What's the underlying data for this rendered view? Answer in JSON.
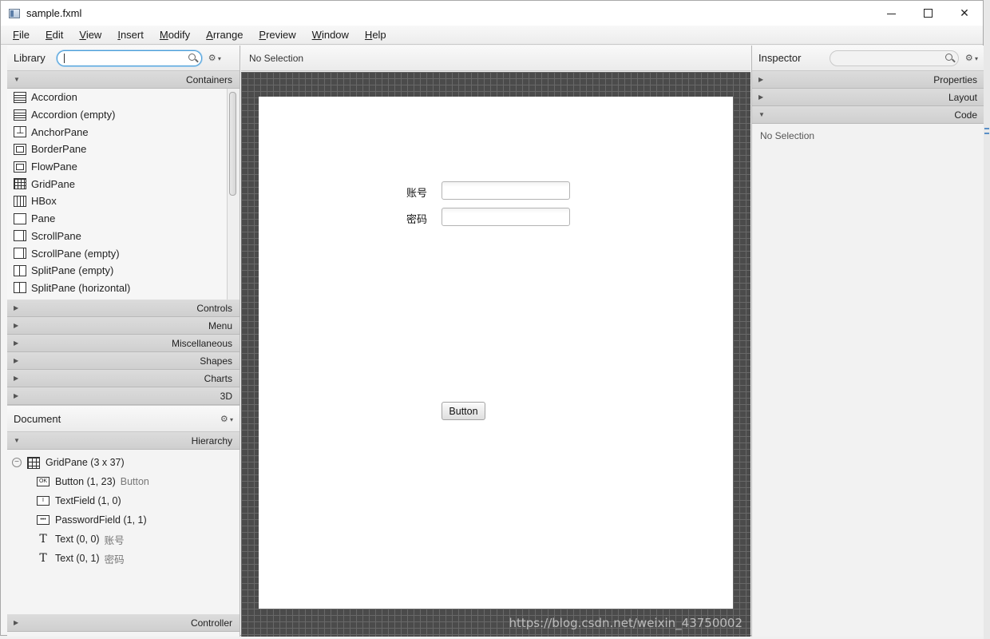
{
  "window": {
    "title": "sample.fxml"
  },
  "menu": [
    {
      "u": "F",
      "rest": "ile"
    },
    {
      "u": "E",
      "rest": "dit"
    },
    {
      "u": "V",
      "rest": "iew"
    },
    {
      "u": "I",
      "rest": "nsert"
    },
    {
      "u": "M",
      "rest": "odify"
    },
    {
      "u": "A",
      "rest": "rrange"
    },
    {
      "u": "P",
      "rest": "review"
    },
    {
      "u": "W",
      "rest": "indow"
    },
    {
      "u": "H",
      "rest": "elp"
    }
  ],
  "library": {
    "title": "Library",
    "search_value": "",
    "sections": {
      "containers": "Containers",
      "controls": "Controls",
      "menu": "Menu",
      "miscellaneous": "Miscellaneous",
      "shapes": "Shapes",
      "charts": "Charts",
      "three_d": "3D"
    },
    "items": [
      {
        "label": "Accordion",
        "icon": "accordion-icon"
      },
      {
        "label": "Accordion  (empty)",
        "icon": "accordion-icon"
      },
      {
        "label": "AnchorPane",
        "icon": "anchorpane-icon"
      },
      {
        "label": "BorderPane",
        "icon": "borderpane-icon"
      },
      {
        "label": "FlowPane",
        "icon": "flowpane-icon"
      },
      {
        "label": "GridPane",
        "icon": "gridpane-icon"
      },
      {
        "label": "HBox",
        "icon": "hbox-icon"
      },
      {
        "label": "Pane",
        "icon": "pane-icon"
      },
      {
        "label": "ScrollPane",
        "icon": "scrollpane-icon"
      },
      {
        "label": "ScrollPane  (empty)",
        "icon": "scrollpane-icon"
      },
      {
        "label": "SplitPane  (empty)",
        "icon": "splitpane-icon"
      },
      {
        "label": "SplitPane  (horizontal)",
        "icon": "splitpane-icon"
      }
    ]
  },
  "document": {
    "title": "Document",
    "hierarchy_label": "Hierarchy",
    "controller_label": "Controller",
    "tree": {
      "root": "GridPane (3 x 37)",
      "children": [
        {
          "label": "Button (1, 23)",
          "sub": "Button",
          "icon": "button-icon",
          "glyph": "OK"
        },
        {
          "label": "TextField (1, 0)",
          "sub": "",
          "icon": "textfield-icon",
          "glyph": "I"
        },
        {
          "label": "PasswordField (1, 1)",
          "sub": "",
          "icon": "passwordfield-icon",
          "glyph": "•••"
        },
        {
          "label": "Text (0, 0)",
          "sub": "账号",
          "icon": "text-icon",
          "glyph": "T"
        },
        {
          "label": "Text (0, 1)",
          "sub": "密码",
          "icon": "text-icon",
          "glyph": "T"
        }
      ]
    }
  },
  "center": {
    "selection": "No Selection",
    "form": {
      "account_label": "账号",
      "password_label": "密码",
      "account_value": "",
      "password_value": "",
      "button_label": "Button"
    }
  },
  "inspector": {
    "title": "Inspector",
    "sections": {
      "properties": "Properties",
      "layout": "Layout",
      "code": "Code"
    },
    "no_selection": "No Selection"
  },
  "watermark": "https://blog.csdn.net/weixin_43750002"
}
